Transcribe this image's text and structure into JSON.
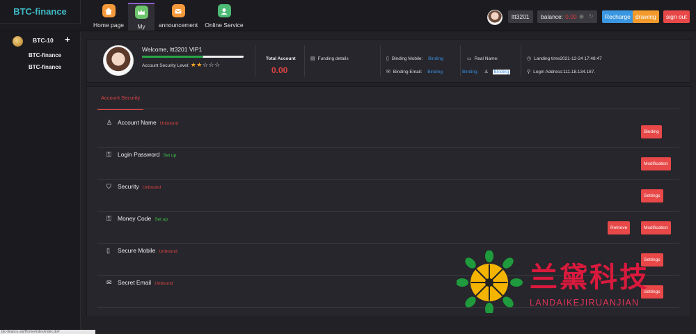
{
  "app": {
    "brand": "BTC-finance"
  },
  "nav": [
    {
      "label": "Home page",
      "icon": "home-icon",
      "color": "#f59a3a"
    },
    {
      "label": "My",
      "icon": "crown-icon",
      "color": "#6cc46c"
    },
    {
      "label": "announcement",
      "icon": "mail-icon",
      "color": "#f59a3a"
    },
    {
      "label": "Online Service",
      "icon": "support-icon",
      "color": "#4cba74"
    }
  ],
  "header": {
    "username": "ltt3201",
    "balance_label": "balance:",
    "balance_value": "0.00",
    "recharge": "Recharge",
    "drawing": "drawing",
    "signout": "sign out"
  },
  "sidebar": {
    "title": "BTC-10",
    "items": [
      "BTC-finance",
      "BTC-finance"
    ]
  },
  "profile": {
    "welcome": "Welcome, ltt3201 VIP1",
    "security_level_label": "Account Security Level:",
    "stars_filled": 2,
    "stars_total": 5,
    "progress": 0.6,
    "total_account_label": "Total Account",
    "total_account_value": "0.00",
    "funding_details": "Funding details",
    "binding_mobile_label": "Binding Mobile:",
    "binding_mobile_link": "Binding",
    "binding_email_label": "Binding Email:",
    "binding_email_link": "Binding",
    "real_name_label": "Real Name:",
    "binding_link_2": "Binding",
    "binding_box": "Binding",
    "landing_time": "Landing time2021-12-24 17:48:47",
    "login_address": "Login Address:111.18.134.187."
  },
  "security": {
    "tab": "Account Security",
    "rows": [
      {
        "icon": "user-icon",
        "name": "Account Name",
        "status": "Unbound",
        "status_color": "red",
        "buttons": [
          "Binding"
        ]
      },
      {
        "icon": "lock-icon",
        "name": "Login Password",
        "status": "Set up",
        "status_color": "green",
        "buttons": [
          "Modification"
        ]
      },
      {
        "icon": "shield-icon",
        "name": "Security",
        "status": "Unbound",
        "status_color": "red",
        "buttons": [
          "Settings"
        ]
      },
      {
        "icon": "lock-icon",
        "name": "Money Code",
        "status": "Set up",
        "status_color": "green",
        "buttons": [
          "Retrieve",
          "Modification"
        ]
      },
      {
        "icon": "mobile-icon",
        "name": "Secure Mobile",
        "status": "Unbound",
        "status_color": "red",
        "buttons": [
          "Settings"
        ]
      },
      {
        "icon": "envelope-icon",
        "name": "Secret Email",
        "status": "Unbound",
        "status_color": "red",
        "buttons": [
          "Settings"
        ]
      }
    ]
  },
  "watermark": {
    "cn": "兰黛科技",
    "en": "LANDAIKEJIRUANJIAN"
  },
  "statusbar": "btc-finance.vip/Home/Index/index.do#"
}
